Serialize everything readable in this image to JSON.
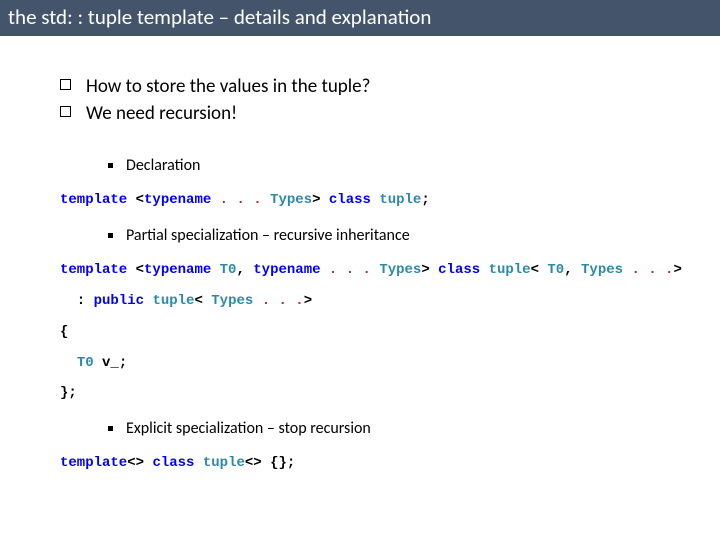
{
  "title": "the std: : tuple template – details and explanation",
  "questions": {
    "q1": "How to store the values in the tuple?",
    "q2": "We need recursion!"
  },
  "sections": {
    "decl_head": "Declaration",
    "partial_head": "Partial specialization – recursive inheritance",
    "explicit_head": "Explicit specialization – stop recursion"
  },
  "code": {
    "decl": {
      "kw_template": "template",
      "lt": " <",
      "kw_typename": "typename",
      "sp1": " ",
      "dots": ". . .",
      "sp2": " ",
      "types": "Types",
      "gt": "> ",
      "kw_class": "class",
      "sp3": " ",
      "tuple": "tuple",
      "semi": ";"
    },
    "partial": {
      "kw_template": "template",
      "lt": " <",
      "kw_typename1": "typename",
      "sp1": " ",
      "t0": "T0",
      "comma": ", ",
      "kw_typename2": "typename",
      "sp2": " ",
      "dots1": ". . .",
      "sp3": " ",
      "types1": "Types",
      "gt1": "> ",
      "kw_class": "class",
      "sp4": " ",
      "tuple1": "tuple",
      "lt2": "< ",
      "t0b": "T0",
      "comma2": ", ",
      "types2": "Types",
      "sp5": " ",
      "dots2": ". . .",
      "gt2": ">",
      "line2_pre": "  : ",
      "kw_public": "public",
      "sp6": " ",
      "tuple2": "tuple",
      "lt3": "< ",
      "types3": "Types",
      "sp7": " ",
      "dots3": ". . .",
      "gt3": ">",
      "lbrace": "{",
      "member_pre": "  ",
      "t0m": "T0",
      "member_post": " v_;",
      "rbrace": "};"
    },
    "explicit": {
      "kw_template": "template",
      "empty1": "<> ",
      "kw_class": "class",
      "sp1": " ",
      "tuple": "tuple",
      "empty2": "<> {};"
    }
  }
}
